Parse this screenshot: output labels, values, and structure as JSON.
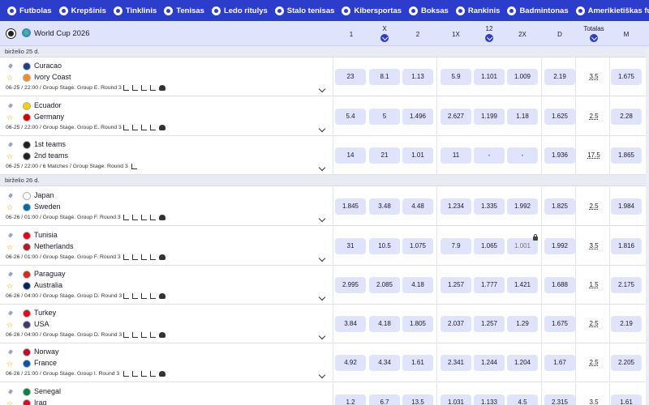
{
  "nav": [
    {
      "label": "Futbolas",
      "icon": "soccer-icon"
    },
    {
      "label": "Krepšinis",
      "icon": "basketball-icon"
    },
    {
      "label": "Tinklinis",
      "icon": "volleyball-icon"
    },
    {
      "label": "Tenisas",
      "icon": "tennis-icon"
    },
    {
      "label": "Ledo ritulys",
      "icon": "hockey-icon"
    },
    {
      "label": "Stalo tenisas",
      "icon": "table-tennis-icon"
    },
    {
      "label": "Kibersportas",
      "icon": "esports-icon"
    },
    {
      "label": "Boksas",
      "icon": "boxing-icon"
    },
    {
      "label": "Rankinis",
      "icon": "handball-icon"
    },
    {
      "label": "Badmintonas",
      "icon": "badminton-icon"
    },
    {
      "label": "Amerikietiškas futbolas",
      "icon": "american-football-icon"
    }
  ],
  "colors": {
    "nav_bg": "#2c3dcb",
    "odd_bg": "#dfe3fb",
    "header_bg": "#dfe3fb",
    "star": "#f0a500"
  },
  "league": {
    "name": "World Cup 2026"
  },
  "columns": {
    "c1": "1",
    "cx": "X",
    "c2": "2",
    "c1x": "1X",
    "c12": "12",
    "c2x": "2X",
    "d": "D",
    "totals": "Totalas",
    "m": "M"
  },
  "dates": {
    "d1": "birželio 25 d.",
    "d2": "birželio 26 d."
  },
  "matches": [
    {
      "home": "Curacao",
      "away": "Ivory Coast",
      "meta": "06-25 / 22:00 / Group Stage. Group E. Round 3",
      "odds": [
        "23",
        "8.1",
        "1.13",
        "5.9",
        "1.101",
        "1.009",
        "2.19"
      ],
      "total": "3.5",
      "m": "1.675"
    },
    {
      "home": "Ecuador",
      "away": "Germany",
      "meta": "06-25 / 22:00 / Group Stage. Group E. Round 3",
      "odds": [
        "5.4",
        "5",
        "1.496",
        "2.627",
        "1.199",
        "1.18",
        "1.625"
      ],
      "total": "2.5",
      "m": "2.28"
    },
    {
      "home": "1st teams",
      "away": "2nd teams",
      "meta": "06-25 / 22:00 / 6 Matches / Group Stage. Round 3",
      "odds": [
        "14",
        "21",
        "1.01",
        "11",
        "-",
        "-",
        "1.936"
      ],
      "total": "17.5",
      "m": "1.865"
    },
    {
      "home": "Japan",
      "away": "Sweden",
      "meta": "06-26 / 01:00 / Group Stage. Group F. Round 3",
      "odds": [
        "1.845",
        "3.48",
        "4.48",
        "1.234",
        "1.335",
        "1.992",
        "1.825"
      ],
      "total": "2.5",
      "m": "1.984"
    },
    {
      "home": "Tunisia",
      "away": "Netherlands",
      "meta": "06-26 / 01:00 / Group Stage. Group F. Round 3",
      "odds": [
        "31",
        "10.5",
        "1.075",
        "7.9",
        "1.065",
        "1.001",
        "1.992"
      ],
      "total": "3.5",
      "m": "1.816"
    },
    {
      "home": "Paraguay",
      "away": "Australia",
      "meta": "06-26 / 04:00 / Group Stage. Group D. Round 3",
      "odds": [
        "2.995",
        "2.085",
        "4.18",
        "1.257",
        "1.777",
        "1.421",
        "1.688"
      ],
      "total": "1.5",
      "m": "2.175"
    },
    {
      "home": "Turkey",
      "away": "USA",
      "meta": "06-26 / 04:00 / Group Stage. Group D. Round 3",
      "odds": [
        "3.84",
        "4.18",
        "1.805",
        "2.037",
        "1.257",
        "1.29",
        "1.675"
      ],
      "total": "2.5",
      "m": "2.19"
    },
    {
      "home": "Norway",
      "away": "France",
      "meta": "06-26 / 21:00 / Group Stage. Group I. Round 3",
      "odds": [
        "4.92",
        "4.34",
        "1.61",
        "2.341",
        "1.244",
        "1.204",
        "1.67"
      ],
      "total": "2.5",
      "m": "2.205"
    },
    {
      "home": "Senegal",
      "away": "Iraq",
      "meta": "",
      "odds": [
        "1.2",
        "6.7",
        "13.5",
        "1.031",
        "1.133",
        "4.5",
        "2.315"
      ],
      "total": "3.5",
      "m": "1.61"
    }
  ]
}
